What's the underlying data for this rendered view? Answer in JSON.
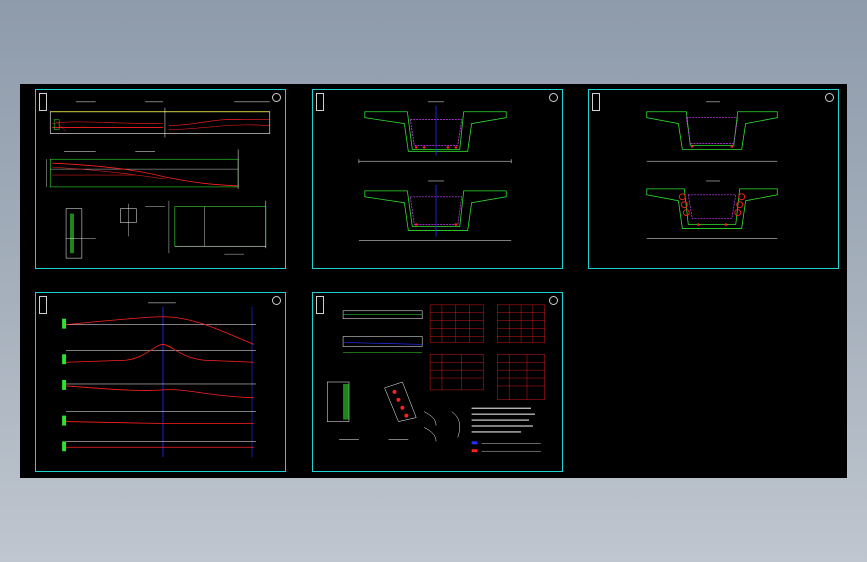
{
  "viewer": {
    "background": "#000000",
    "frame_color": "#1fd1d1",
    "sheet_count": 5
  },
  "sheets": [
    {
      "id": "sheet-1",
      "content": "tendon-elevation-and-plan"
    },
    {
      "id": "sheet-2",
      "content": "box-girder-sections-a"
    },
    {
      "id": "sheet-3",
      "content": "box-girder-sections-b"
    },
    {
      "id": "sheet-4",
      "content": "tendon-profiles"
    },
    {
      "id": "sheet-5",
      "content": "anchor-details-and-tables"
    }
  ],
  "colors": {
    "tendon": "#ff2020",
    "outline": "#ffffff",
    "section": "#30e030",
    "axis": "#2030ff",
    "duct": "#d040ff",
    "frame": "#1fd1d1",
    "dim": "#ffff40"
  }
}
